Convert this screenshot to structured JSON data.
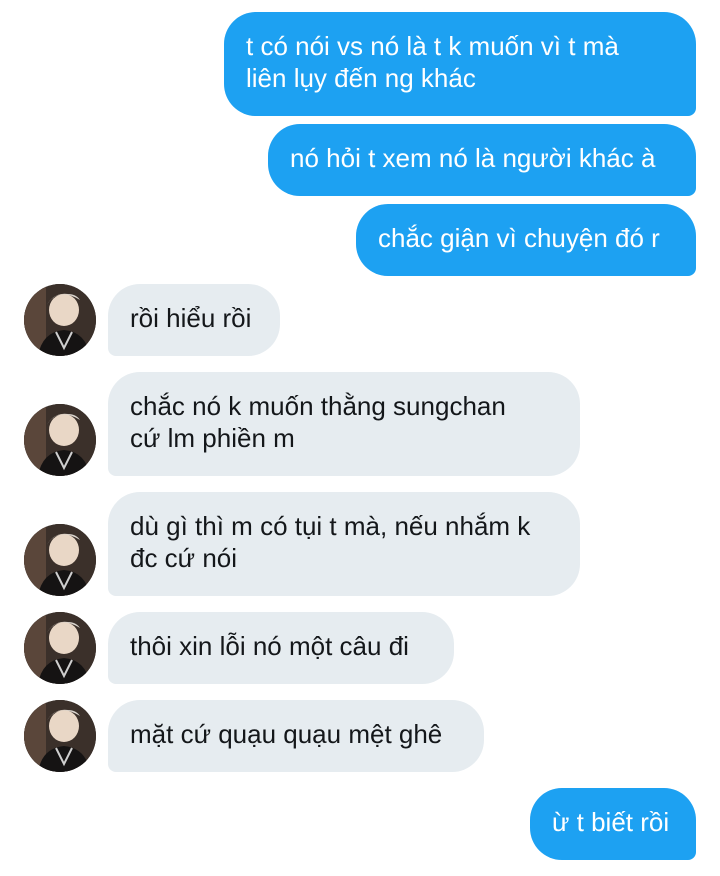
{
  "messages": [
    {
      "side": "sent",
      "text": "t có nói vs nó là t k muốn vì t mà\nliên lụy đến ng khác"
    },
    {
      "side": "sent",
      "text": "nó hỏi t xem nó là người khác à"
    },
    {
      "side": "sent",
      "text": "chắc giận vì chuyện đó r"
    },
    {
      "side": "received",
      "text": "rồi hiểu rồi"
    },
    {
      "side": "received",
      "text": "chắc nó k muốn thằng sungchan\ncứ lm phiền m"
    },
    {
      "side": "received",
      "text": "dù gì thì m có tụi t mà, nếu nhắm k\nđc cứ nói"
    },
    {
      "side": "received",
      "text": "thôi xin lỗi nó một câu đi"
    },
    {
      "side": "received",
      "text": "mặt cứ quạu quạu mệt ghê"
    },
    {
      "side": "sent",
      "text": "ừ t biết rồi"
    }
  ],
  "colors": {
    "sent_bubble": "#1da1f2",
    "received_bubble": "#e6ecf0"
  },
  "icons": {
    "avatar": "contact-avatar-photo"
  }
}
